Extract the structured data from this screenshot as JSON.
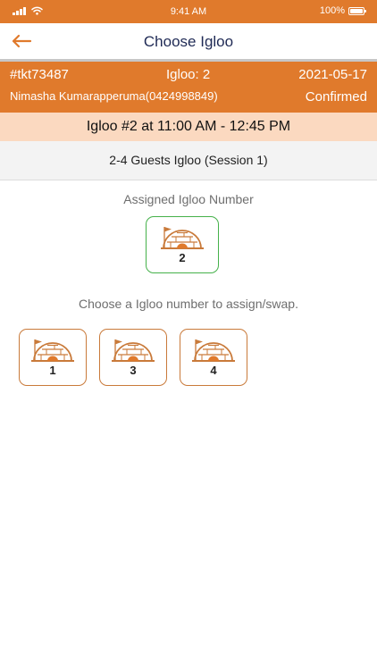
{
  "status_bar": {
    "time": "9:41 AM",
    "battery": "100%"
  },
  "header": {
    "title": "Choose Igloo"
  },
  "ticket": {
    "id": "#tkt73487",
    "igloo": "Igloo: 2",
    "date": "2021-05-17",
    "customer": "Nimasha Kumarapperuma(0424998849)",
    "status": "Confirmed"
  },
  "booking": {
    "slot": "Igloo #2 at 11:00 AM - 12:45 PM",
    "session": "2-4 Guests Igloo (Session 1)"
  },
  "assigned": {
    "label": "Assigned Igloo Number",
    "number": "2"
  },
  "choose": {
    "label": "Choose a Igloo number to assign/swap.",
    "options": [
      {
        "number": "1"
      },
      {
        "number": "3"
      },
      {
        "number": "4"
      }
    ]
  },
  "colors": {
    "accent": "#e07a2c",
    "highlight": "#fbd9c0",
    "assigned_border": "#45b14a",
    "nav_title": "#1f2a55"
  }
}
